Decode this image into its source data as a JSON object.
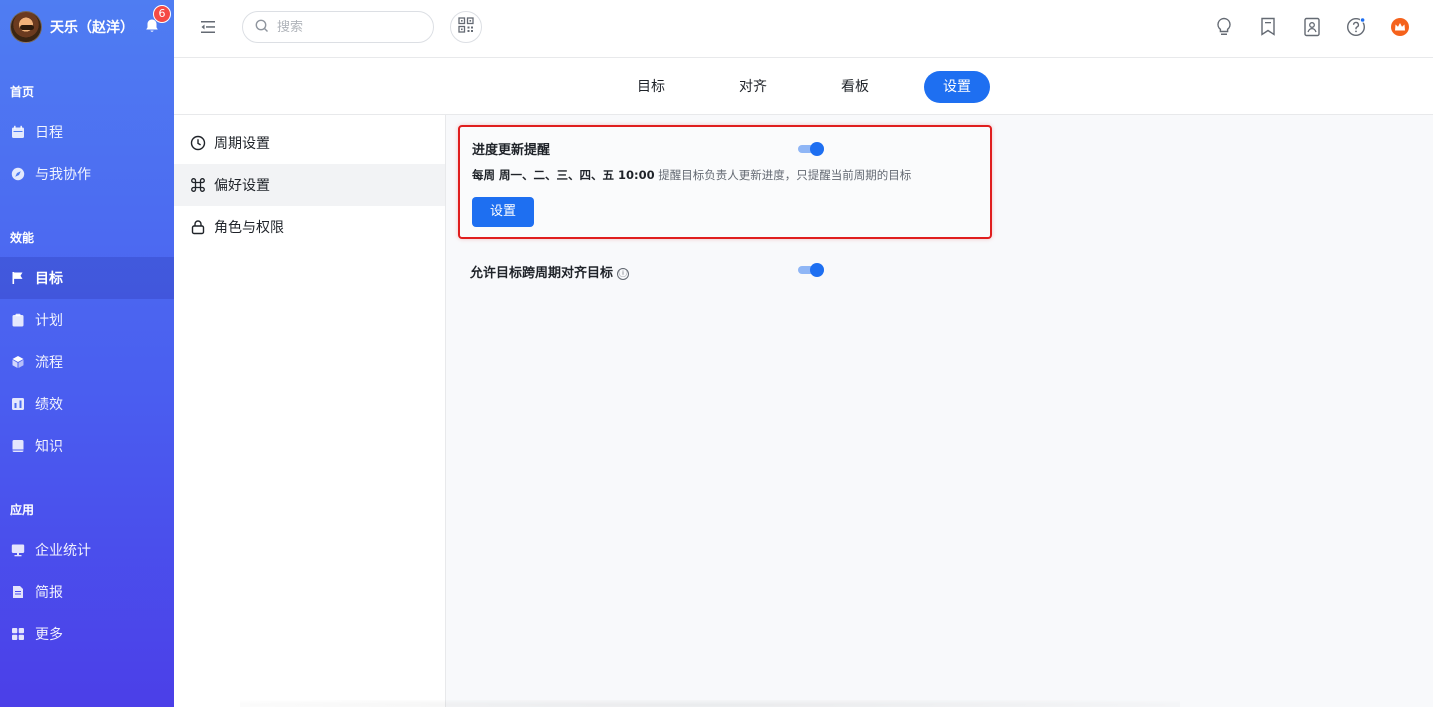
{
  "user": {
    "name": "天乐（赵洋）",
    "notification_count": "6"
  },
  "sidebar": {
    "sections": [
      {
        "label": "首页",
        "items": [
          {
            "label": "日程",
            "icon": "calendar-icon"
          },
          {
            "label": "与我协作",
            "icon": "compass-icon"
          }
        ]
      },
      {
        "label": "效能",
        "items": [
          {
            "label": "目标",
            "icon": "flag-icon",
            "active": true
          },
          {
            "label": "计划",
            "icon": "clipboard-icon"
          },
          {
            "label": "流程",
            "icon": "cube-icon"
          },
          {
            "label": "绩效",
            "icon": "chart-icon"
          },
          {
            "label": "知识",
            "icon": "book-icon"
          }
        ]
      },
      {
        "label": "应用",
        "items": [
          {
            "label": "企业统计",
            "icon": "monitor-icon"
          },
          {
            "label": "简报",
            "icon": "document-icon"
          },
          {
            "label": "更多",
            "icon": "grid-icon"
          }
        ]
      }
    ]
  },
  "search": {
    "placeholder": "搜索"
  },
  "tabs": [
    {
      "label": "目标"
    },
    {
      "label": "对齐"
    },
    {
      "label": "看板"
    },
    {
      "label": "设置",
      "active": true
    }
  ],
  "settings_menu": [
    {
      "label": "周期设置",
      "icon": "clock-icon"
    },
    {
      "label": "偏好设置",
      "icon": "command-icon",
      "active": true
    },
    {
      "label": "角色与权限",
      "icon": "lock-icon"
    }
  ],
  "options": {
    "progress_reminder": {
      "title": "进度更新提醒",
      "enabled": true,
      "schedule": "每周 周一、二、三、四、五 10:00",
      "description": "提醒目标负责人更新进度，只提醒当前周期的目标",
      "button": "设置"
    },
    "cross_cycle_alignment": {
      "title": "允许目标跨周期对齐目标",
      "info_icon": "ⓘ",
      "enabled": true
    }
  },
  "colors": {
    "primary": "#1e6ff1",
    "sidebar_top": "#4f7df2",
    "sidebar_bottom": "#4b3fe8",
    "highlight_border": "#e01e1e",
    "badge": "#f54a45"
  }
}
